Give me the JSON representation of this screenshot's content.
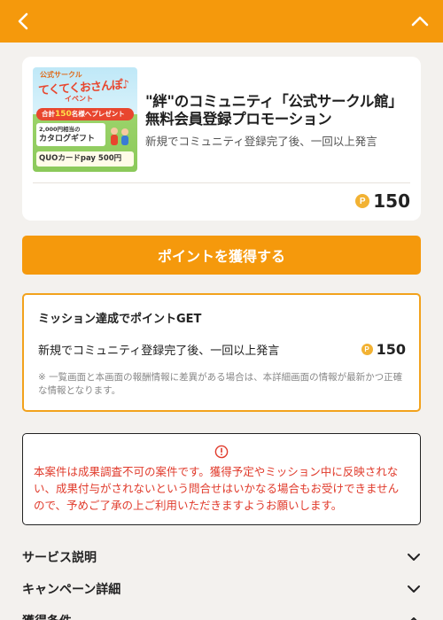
{
  "header": {
    "back_icon": "chevron-left-icon",
    "collapse_icon": "chevron-up-icon",
    "bg_color": "#f5990c"
  },
  "offer": {
    "thumbnail": {
      "line1": "公式サークル",
      "line2": "てくてくおさんぽ♪",
      "line3": "イベント",
      "band_prefix": "合計",
      "band_count": "150",
      "band_suffix": "名様へプレゼント",
      "gift_amount": "2,000円相当の",
      "gift_label": "カタログギフト",
      "quo": "QUOカードpay 500円"
    },
    "title": "\"絆\"のコミュニティ「公式サークル館」無料会員登録プロモーション",
    "subtitle": "新規でコミュニティ登録完了後、一回以上発言",
    "coin_symbol": "P",
    "points": "150"
  },
  "cta": {
    "label": "ポイントを獲得する"
  },
  "mission": {
    "heading": "ミッション達成でポイントGET",
    "task": "新規でコミュニティ登録完了後、一回以上発言",
    "coin_symbol": "P",
    "points": "150",
    "note": "※ 一覧画面と本画面の報酬情報に差異がある場合は、本詳細画面の情報が最新かつ正確な情報となります。"
  },
  "warning": {
    "icon": "info-icon",
    "text": "本案件は成果調査不可の案件です。獲得予定やミッション中に反映されない、成果付与がされないという問合せはいかなる場合もお受けできませんので、予めご了承の上ご利用いただきますようお願いします。"
  },
  "accordion": [
    {
      "label": "サービス説明",
      "icon": "chevron-down-icon"
    },
    {
      "label": "キャンペーン詳細",
      "icon": "chevron-down-icon"
    },
    {
      "label": "獲得条件",
      "icon": "chevron-up-icon"
    }
  ]
}
